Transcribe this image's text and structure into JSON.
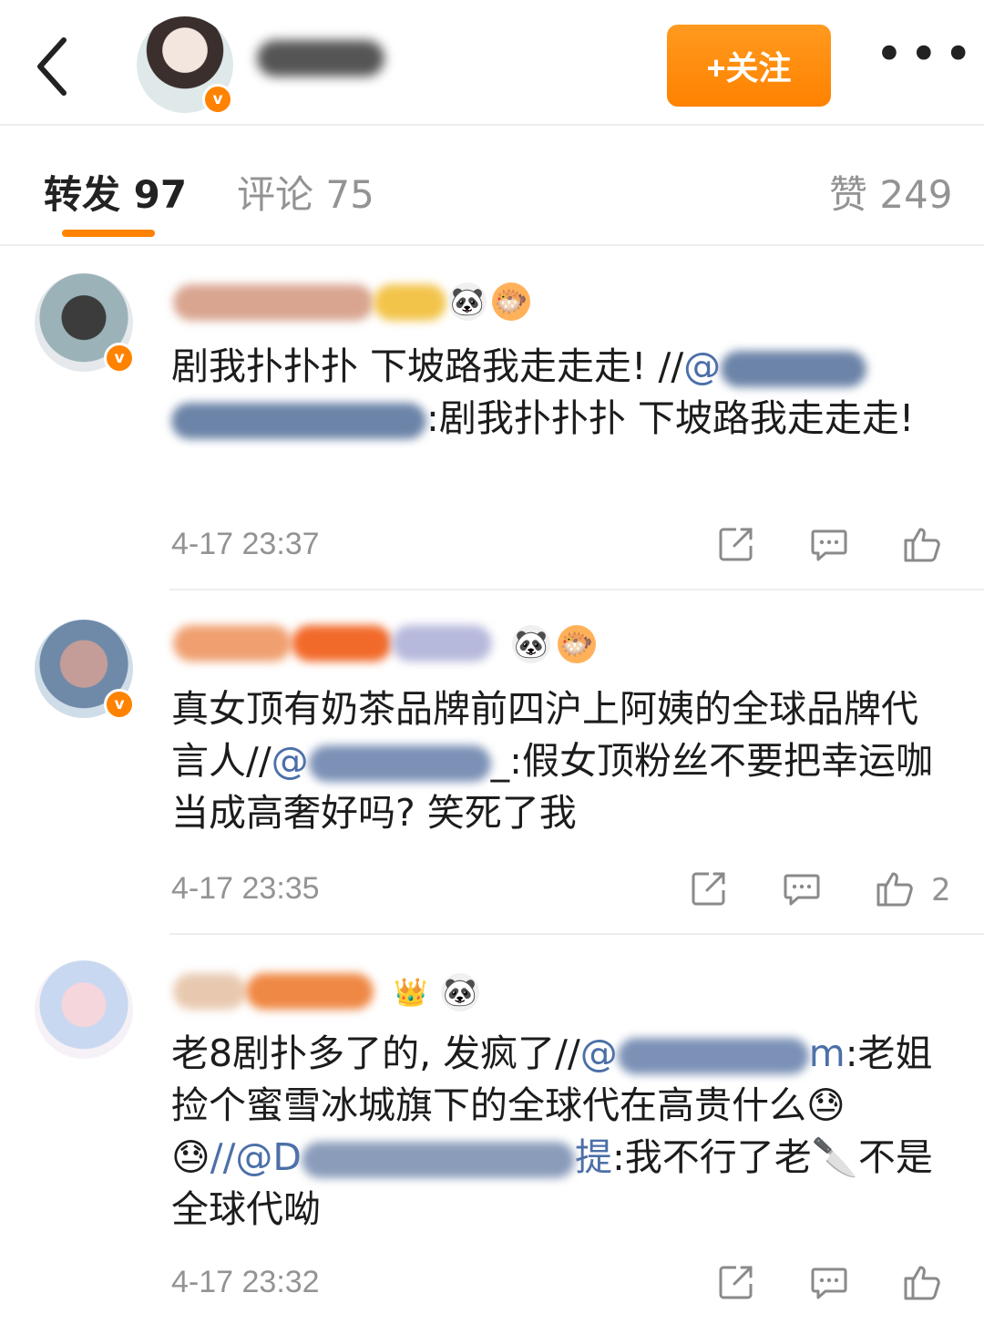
{
  "header": {
    "follow_label": "+关注",
    "more_label": "•••",
    "accent": "#ff8200"
  },
  "tabs": [
    {
      "label": "转发 97",
      "active": true
    },
    {
      "label": "评论 75",
      "active": false
    },
    {
      "label": "赞 249",
      "active": false
    }
  ],
  "comments": [
    {
      "text_a": "剧我扑扑扑 下坡路我走走走! //",
      "mention_a": "@",
      "text_b": ":剧我扑扑扑 下坡路我走走走!",
      "time": "4-17 23:37",
      "likes": ""
    },
    {
      "text_a": "真女顶有奶茶品牌前四沪上阿姨的全球品牌代言人//",
      "mention_a": "@",
      "text_b": "_:假女顶粉丝不要把幸运咖当成高奢好吗? 笑死了我",
      "time": "4-17 23:35",
      "likes": "2"
    },
    {
      "text_a": "老8剧扑多了的, 发疯了//",
      "mention_a": "@",
      "text_b_mention_end": "m",
      "text_b": ":老姐捡个蜜雪冰城旗下的全球代在高贵什么",
      "emoji": "😓😓",
      "mention_c": "//@D",
      "mention_c_end": "提",
      "text_c": ":我不行了老",
      "knife": "🔪",
      "text_d": "不是全球代呦",
      "time": "4-17 23:32",
      "likes": ""
    }
  ],
  "icons": [
    "back-icon",
    "verified-icon",
    "panda-icon",
    "fish-icon",
    "crown-icon",
    "share-icon",
    "comment-icon",
    "like-icon"
  ]
}
